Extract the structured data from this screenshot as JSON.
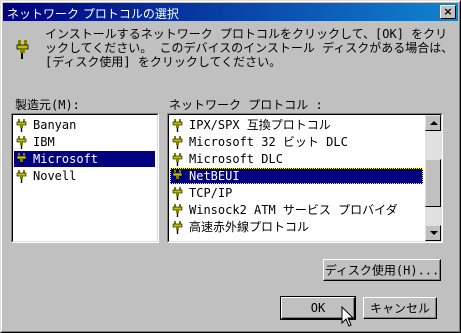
{
  "window": {
    "title": "ネットワーク プロトコルの選択",
    "close_label": "×"
  },
  "instruction": "インストールするネットワーク プロトコルをクリックして、[OK] をクリックしてください。 このデバイスのインストール ディスクがある場合は、[ディスク使用] をクリックしてください。",
  "manufacturers": {
    "label": "製造元(M):",
    "items": [
      "Banyan",
      "IBM",
      "Microsoft",
      "Novell"
    ],
    "selected": "Microsoft"
  },
  "protocols": {
    "label": "ネットワーク プロトコル :",
    "items": [
      "IPX/SPX 互換プロトコル",
      "Microsoft 32 ビット DLC",
      "Microsoft DLC",
      "NetBEUI",
      "TCP/IP",
      "Winsock2 ATM サービス プロバイダ",
      "高速赤外線プロトコル"
    ],
    "selected": "NetBEUI"
  },
  "buttons": {
    "have_disk": "ディスク使用(H)...",
    "ok": "OK",
    "cancel": "キャンセル"
  },
  "icons": {
    "protocol": "network-cable-icon",
    "instruction": "network-plug-icon"
  }
}
